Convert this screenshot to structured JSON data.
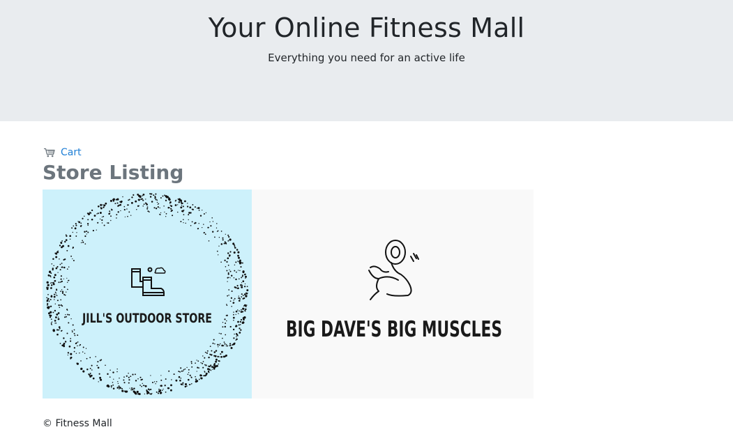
{
  "header": {
    "title": "Your Online Fitness Mall",
    "subtitle": "Everything you need for an active life"
  },
  "nav": {
    "cart_label": "Cart",
    "cart_icon": "cart-icon"
  },
  "main": {
    "heading": "Store Listing",
    "stores": [
      {
        "name": "JILL'S OUTDOOR STORE",
        "logo_bg": "#cdf1fb",
        "icon": "boots-icon"
      },
      {
        "name": "BIG DAVE'S BIG MUSCLES",
        "logo_bg": "#f9f9f9",
        "icon": "flexed-arm-dumbbell-icon"
      }
    ]
  },
  "footer": {
    "text": "© Fitness Mall"
  },
  "colors": {
    "header_bg": "#e9ecef",
    "link": "#1f7fd6",
    "heading": "#6c757d"
  }
}
